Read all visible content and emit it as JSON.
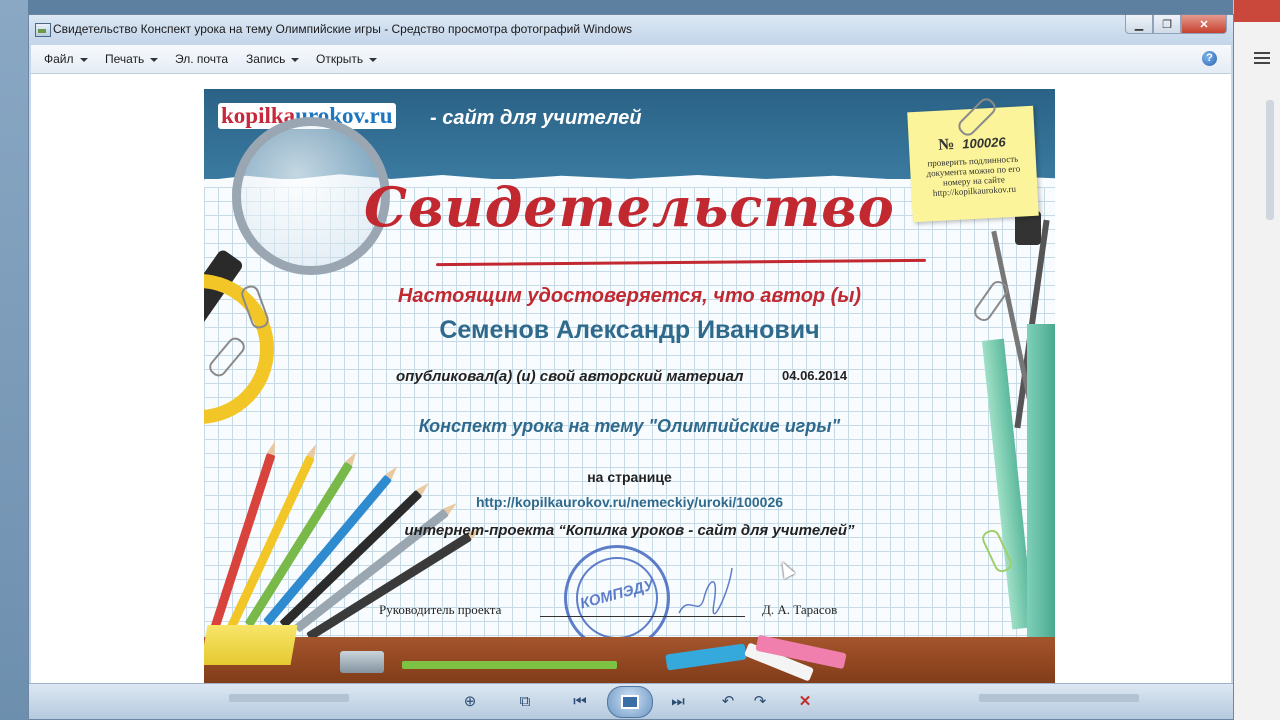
{
  "window": {
    "title": "Свидетельство Конспект урока на тему Олимпийские игры - Средство просмотра фотографий Windows",
    "minimize": "▁",
    "maximize": "❐",
    "close": "✕"
  },
  "menu": {
    "file": "Файл",
    "print": "Печать",
    "email": "Эл. почта",
    "burn": "Запись",
    "open": "Открыть",
    "help": "?"
  },
  "certificate": {
    "logo_part1": "kopilka",
    "logo_part2": "urokov.ru",
    "tagline": "- сайт для учителей",
    "number_sign": "№",
    "number": "100026",
    "verify_text": "проверить подлинность документа можно по его номеру на сайте http://kopilkaurokov.ru",
    "title": "Свидетельство",
    "certifies": "Настоящим удостоверяется, что автор (ы)",
    "author": "Семенов Александр Иванович",
    "published": "опубликовал(а) (и) свой авторский материал",
    "date": "04.06.2014",
    "material": "Конспект урока на тему \"Олимпийские игры\"",
    "on_page": "на странице",
    "url": "http://kopilkaurokov.ru/nemeckiy/uroki/100026",
    "project": "интернет-проекта “Копилка уроков - сайт для учителей”",
    "head_label": "Руководитель проекта",
    "head_name": "Д. А. Тарасов",
    "stamp": "КОМПЭДУ"
  },
  "controls": {
    "zoom": "⊕",
    "fit": "⧉",
    "prev": "⏮",
    "next": "⏭",
    "rotate_left": "↶",
    "rotate_right": "↷",
    "delete": "✕"
  },
  "colors": {
    "accent_red": "#c12830",
    "accent_blue": "#2f6a8c"
  }
}
